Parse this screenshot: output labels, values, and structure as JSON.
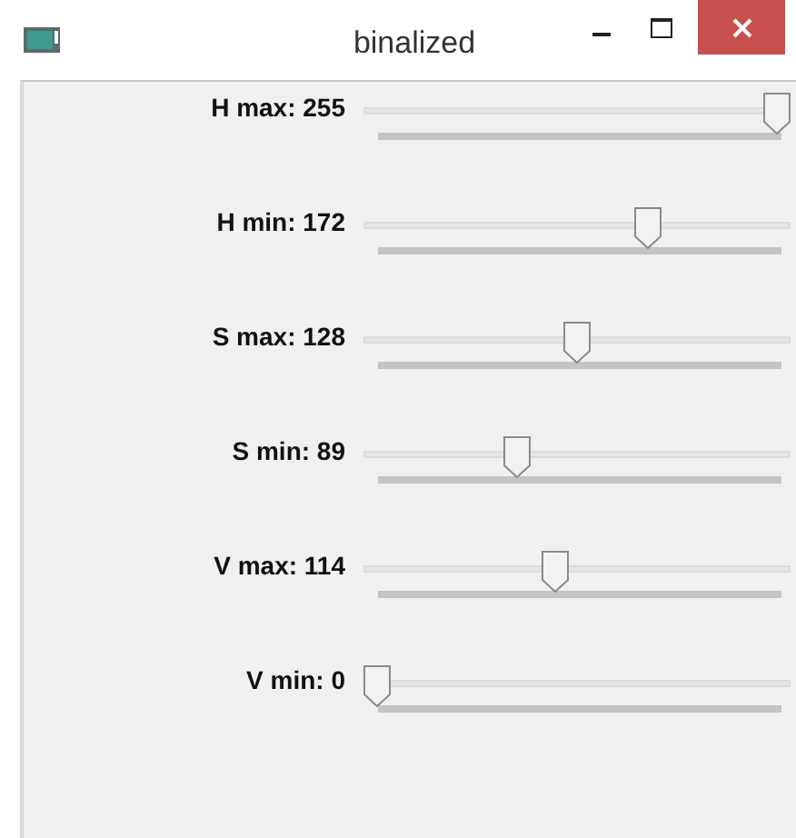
{
  "window": {
    "title": "binalized"
  },
  "trackbars": [
    {
      "label": "H max: 255",
      "level": 1
    },
    {
      "label": "H min: 172",
      "level": 0.675
    },
    {
      "label": "S max: 128",
      "level": 0.502
    },
    {
      "label": "S min: 89",
      "level": 0.349
    },
    {
      "label": "V max: 114",
      "level": 0.447
    },
    {
      "label": "V min: 0",
      "level": 0
    }
  ]
}
